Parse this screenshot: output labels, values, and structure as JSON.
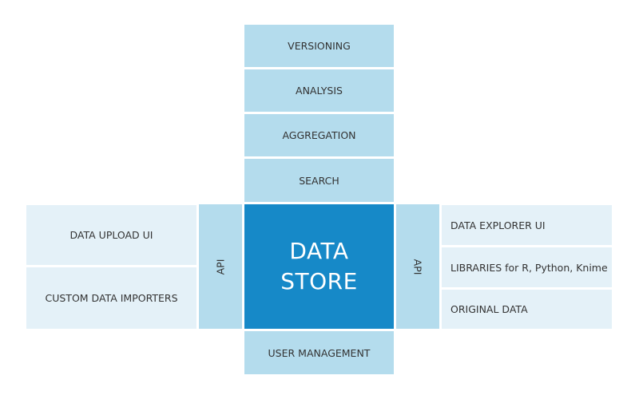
{
  "diagram": {
    "top_stack": [
      "VERSIONING",
      "ANALYSIS",
      "AGGREGATION",
      "SEARCH"
    ],
    "core": {
      "line1": "DATA",
      "line2": "STORE"
    },
    "bottom": "USER MANAGEMENT",
    "left_api": "API",
    "right_api": "API",
    "left_items": [
      "DATA UPLOAD UI",
      "CUSTOM DATA IMPORTERS"
    ],
    "right_items": [
      "DATA EXPLORER UI",
      "LIBRARIES for R, Python, Knime",
      "ORIGINAL DATA"
    ]
  },
  "colors": {
    "core": "#1689c8",
    "module": "#b4dced",
    "client": "#e4f1f8"
  }
}
